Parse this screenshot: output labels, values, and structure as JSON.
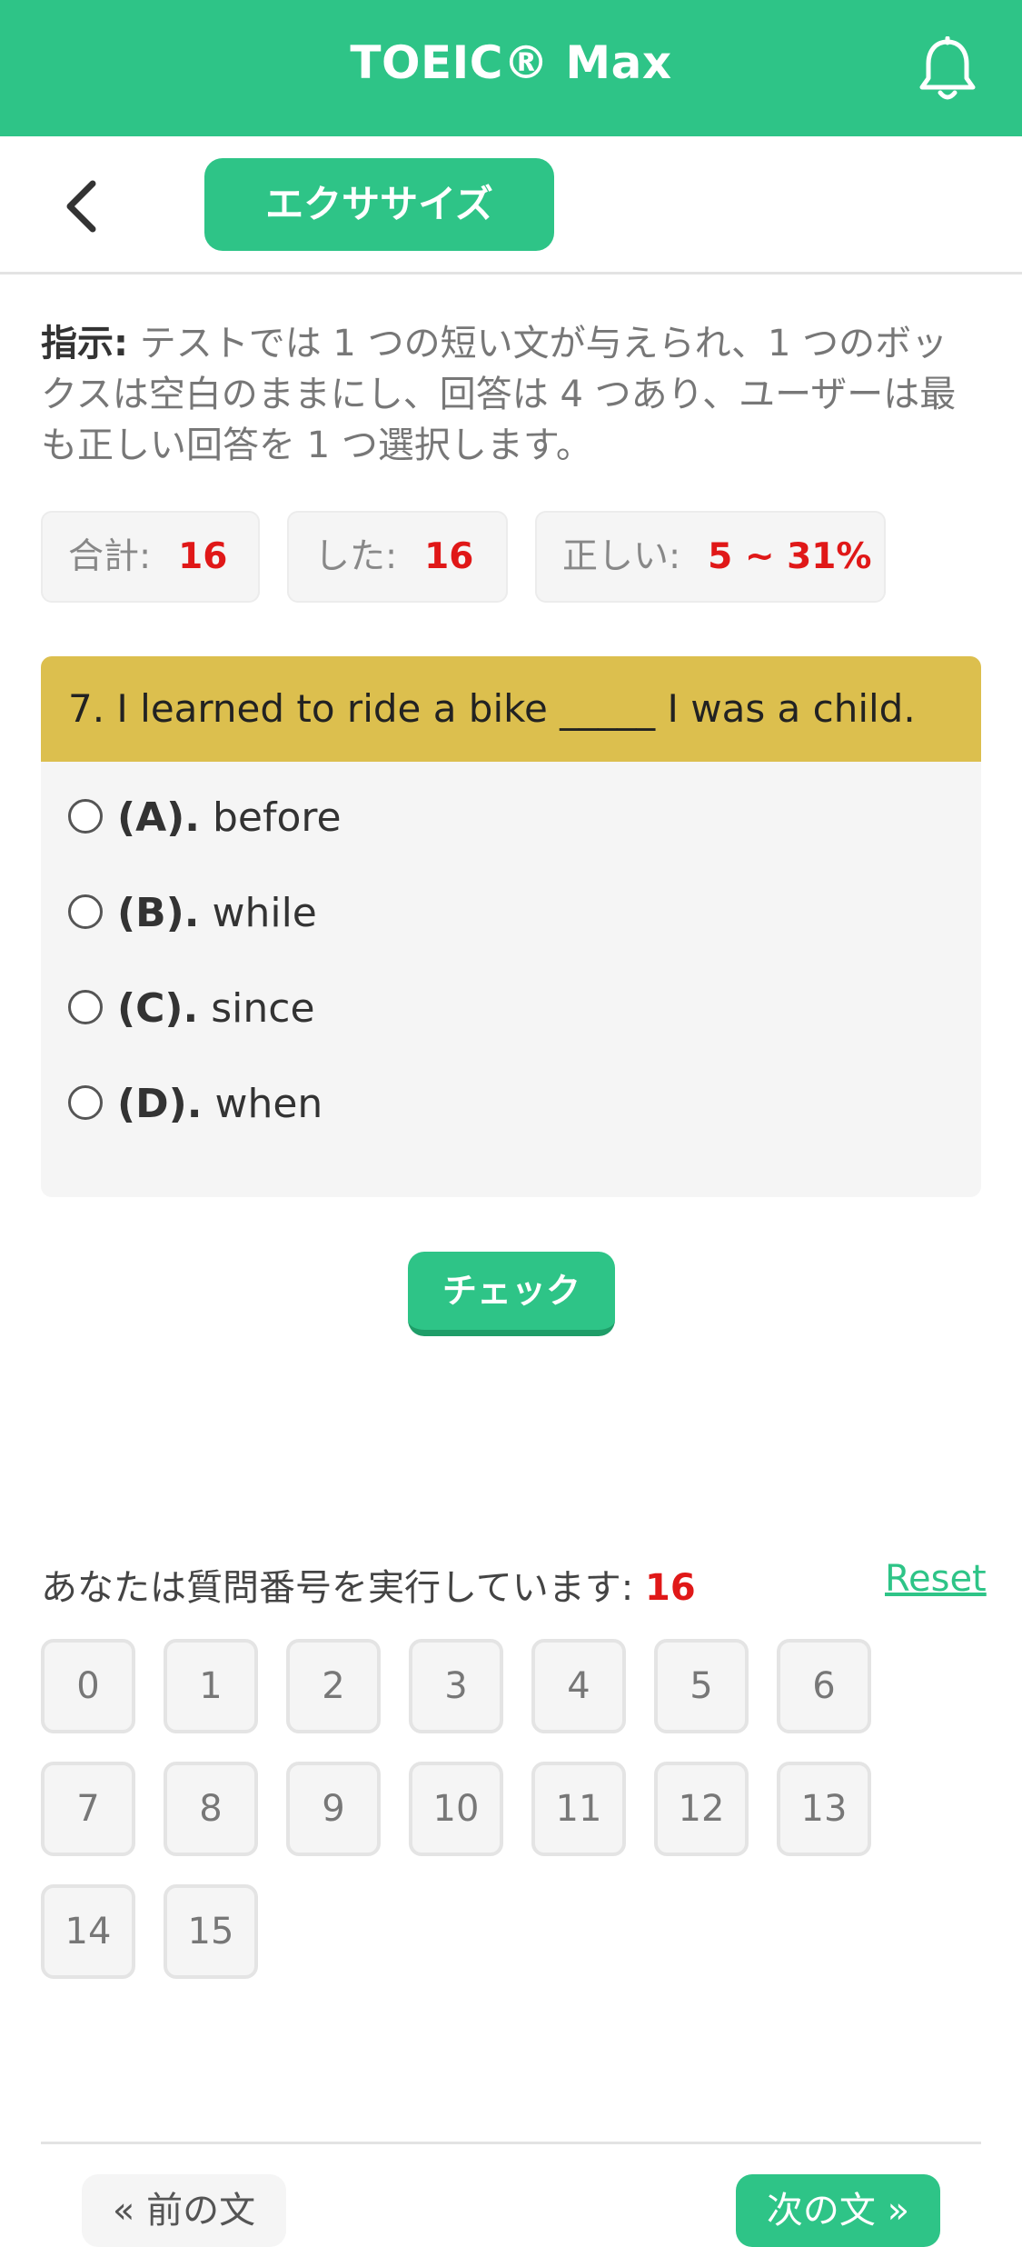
{
  "header": {
    "title": "TOEIC® Max",
    "bell_icon": "bell-icon"
  },
  "subbar": {
    "back_icon": "chevron-left-icon",
    "tab_label": "エクササイズ"
  },
  "instruction": {
    "label": "指示:",
    "text": " テストでは 1 つの短い文が与えられ、1 つのボックスは空白のままにし、回答は 4 つあり、ユーザーは最も正しい回答を 1 つ選択します。"
  },
  "stats": {
    "total_label": "合計:",
    "total_value": "16",
    "done_label": "した:",
    "done_value": "16",
    "correct_label": "正しい:",
    "correct_value": "5 ~ 31%"
  },
  "question": {
    "text": "7. I learned to ride a bike _____ I was a child.",
    "options": [
      {
        "key": "(A).",
        "text": "before"
      },
      {
        "key": "(B).",
        "text": "while"
      },
      {
        "key": "(C).",
        "text": "since"
      },
      {
        "key": "(D).",
        "text": "when"
      }
    ]
  },
  "check_label": "チェック",
  "progress": {
    "label": "あなたは質問番号を実行しています:",
    "current": "16",
    "reset_label": "Reset"
  },
  "question_numbers": [
    "0",
    "1",
    "2",
    "3",
    "4",
    "5",
    "6",
    "7",
    "8",
    "9",
    "10",
    "11",
    "12",
    "13",
    "14",
    "15"
  ],
  "footer": {
    "prev_label": "« 前の文",
    "next_label": "次の文 »"
  },
  "colors": {
    "accent": "#2ec487",
    "question_bar": "#dcbf4e",
    "highlight": "#e01818"
  }
}
